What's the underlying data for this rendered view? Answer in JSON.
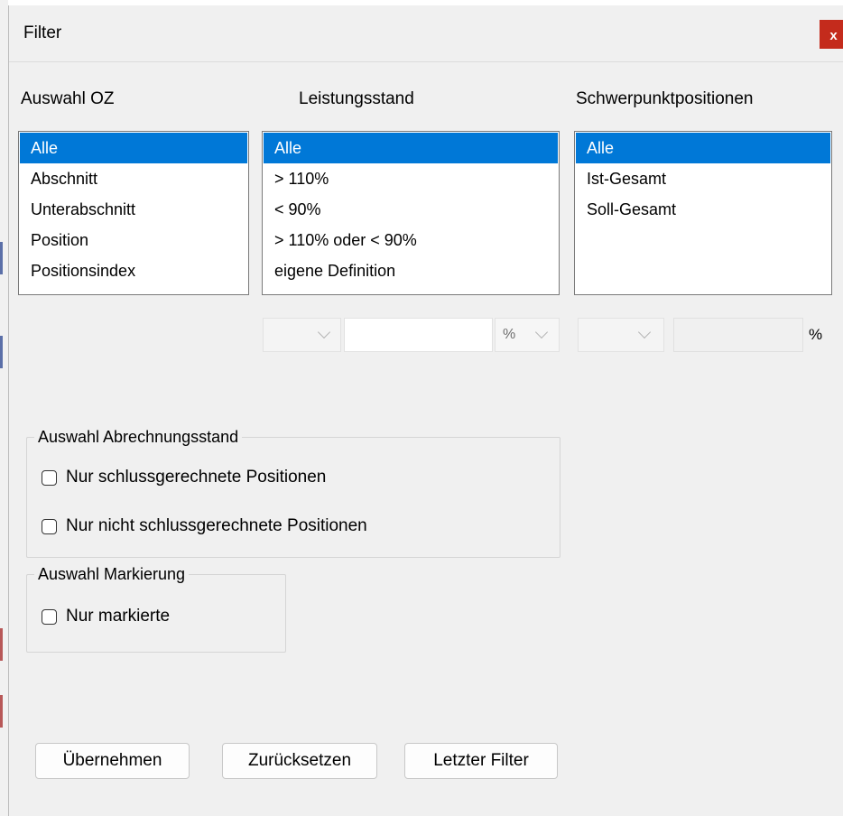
{
  "dialog": {
    "title": "Filter",
    "close_label": "x"
  },
  "columns": {
    "oz": {
      "label": "Auswahl OZ",
      "items": [
        "Alle",
        "Abschnitt",
        "Unterabschnitt",
        "Position",
        "Positionsindex"
      ],
      "selected": "Alle"
    },
    "leistungsstand": {
      "label": "Leistungsstand",
      "items": [
        "Alle",
        "> 110%",
        "< 90%",
        "> 110% oder < 90%",
        "eigene Definition"
      ],
      "selected": "Alle",
      "unit": "%"
    },
    "schwerpunkt": {
      "label": "Schwerpunktpositionen",
      "items": [
        "Alle",
        "Ist-Gesamt",
        "Soll-Gesamt"
      ],
      "selected": "Alle",
      "unit": "%"
    }
  },
  "abrechnung": {
    "legend": "Auswahl Abrechnungsstand",
    "options": [
      "Nur schlussgerechnete Positionen",
      "Nur nicht schlussgerechnete Positionen"
    ],
    "checked": [
      false,
      false
    ]
  },
  "markierung": {
    "legend": "Auswahl Markierung",
    "option": "Nur markierte",
    "checked": false
  },
  "buttons": {
    "apply": "Übernehmen",
    "reset": "Zurücksetzen",
    "last_filter": "Letzter Filter"
  },
  "colors": {
    "selection": "#0078d7",
    "close_button": "#c42b1c",
    "dialog_bg": "#f0f0f0"
  }
}
